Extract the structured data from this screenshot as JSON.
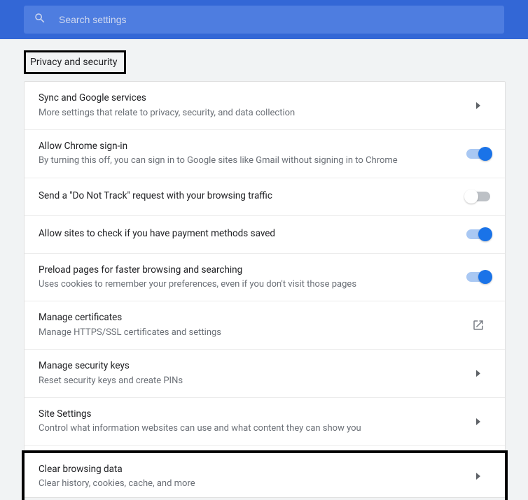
{
  "search": {
    "placeholder": "Search settings"
  },
  "section": {
    "title": "Privacy and security"
  },
  "rows": {
    "sync": {
      "title": "Sync and Google services",
      "desc": "More settings that relate to privacy, security, and data collection"
    },
    "signin": {
      "title": "Allow Chrome sign-in",
      "desc": "By turning this off, you can sign in to Google sites like Gmail without signing in to Chrome"
    },
    "dnt": {
      "title": "Send a \"Do Not Track\" request with your browsing traffic"
    },
    "payment": {
      "title": "Allow sites to check if you have payment methods saved"
    },
    "preload": {
      "title": "Preload pages for faster browsing and searching",
      "desc": "Uses cookies to remember your preferences, even if you don't visit those pages"
    },
    "certs": {
      "title": "Manage certificates",
      "desc": "Manage HTTPS/SSL certificates and settings"
    },
    "seckeys": {
      "title": "Manage security keys",
      "desc": "Reset security keys and create PINs"
    },
    "sitesettings": {
      "title": "Site Settings",
      "desc": "Control what information websites can use and what content they can show you"
    },
    "clear": {
      "title": "Clear browsing data",
      "desc": "Clear history, cookies, cache, and more"
    }
  },
  "toggles": {
    "signin": true,
    "dnt": false,
    "payment": true,
    "preload": true
  }
}
